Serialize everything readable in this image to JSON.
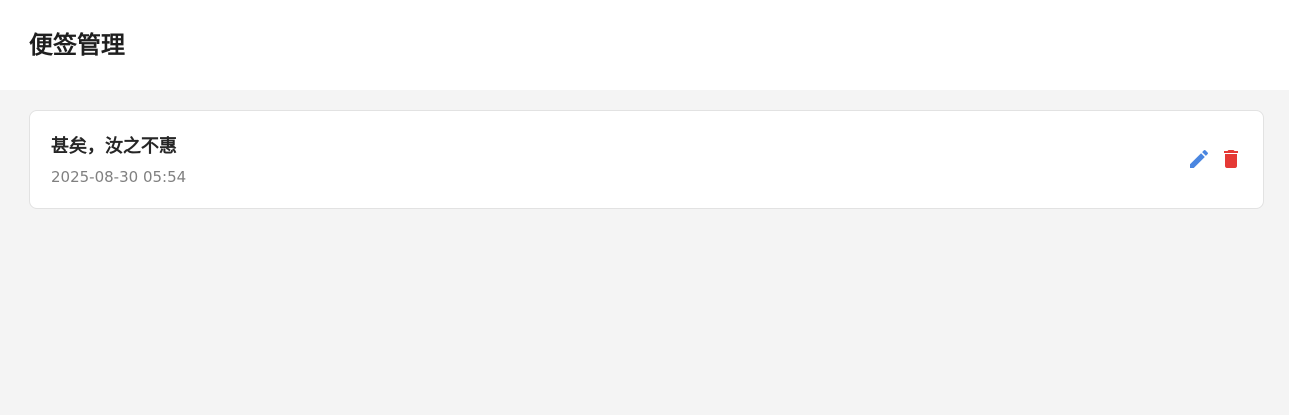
{
  "header": {
    "title": "便签管理"
  },
  "notes": [
    {
      "title": "甚矣，汝之不惠",
      "time": "2025-08-30 05:54",
      "actions": {
        "edit_icon": "pencil-icon",
        "delete_icon": "trash-icon"
      }
    }
  ],
  "colors": {
    "edit": "#4a86e0",
    "delete": "#e53935",
    "background": "#f4f4f4",
    "card": "#ffffff"
  }
}
